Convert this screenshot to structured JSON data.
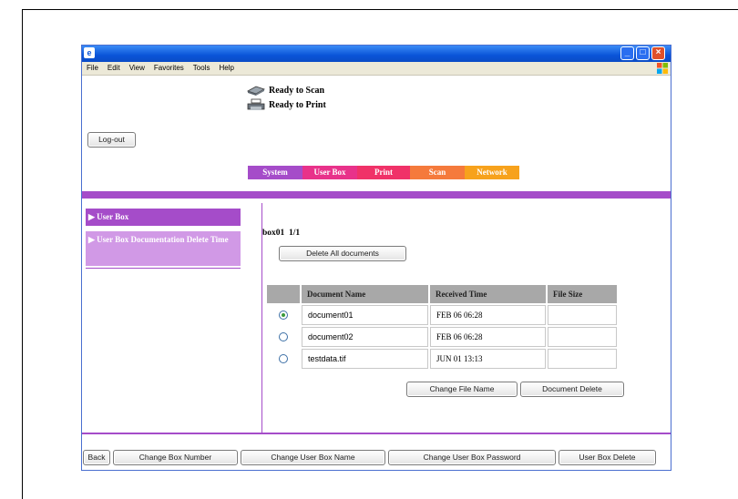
{
  "window": {
    "menu": [
      "File",
      "Edit",
      "View",
      "Favorites",
      "Tools",
      "Help"
    ]
  },
  "status": {
    "scan": "Ready to Scan",
    "print": "Ready to Print"
  },
  "logout_label": "Log-out",
  "tabs": [
    {
      "label": "System",
      "color": "#a54cc9"
    },
    {
      "label": "User Box",
      "color": "#e8328a"
    },
    {
      "label": "Print",
      "color": "#f03268"
    },
    {
      "label": "Scan",
      "color": "#f57a3c"
    },
    {
      "label": "Network",
      "color": "#f7a21c"
    }
  ],
  "sidebar": {
    "items": [
      {
        "label": "User Box",
        "active": true
      },
      {
        "label": "User Box Documentation Delete Time",
        "active": false
      }
    ]
  },
  "main": {
    "box_label": "box01",
    "page_label": "1/1",
    "delete_all_label": "Delete All documents",
    "table": {
      "headers": [
        "",
        "Document Name",
        "Received Time",
        "File Size"
      ],
      "rows": [
        {
          "selected": true,
          "name": "document01",
          "time": "FEB 06 06:28",
          "size": ""
        },
        {
          "selected": false,
          "name": "document02",
          "time": "FEB 06 06:28",
          "size": ""
        },
        {
          "selected": false,
          "name": "testdata.tif",
          "time": "JUN 01 13:13",
          "size": ""
        }
      ]
    },
    "change_file_name_label": "Change File Name",
    "document_delete_label": "Document Delete"
  },
  "footer": {
    "back": "Back",
    "change_box_number": "Change Box Number",
    "change_user_box_name": "Change User Box Name",
    "change_user_box_password": "Change User Box Password",
    "user_box_delete": "User Box Delete"
  }
}
